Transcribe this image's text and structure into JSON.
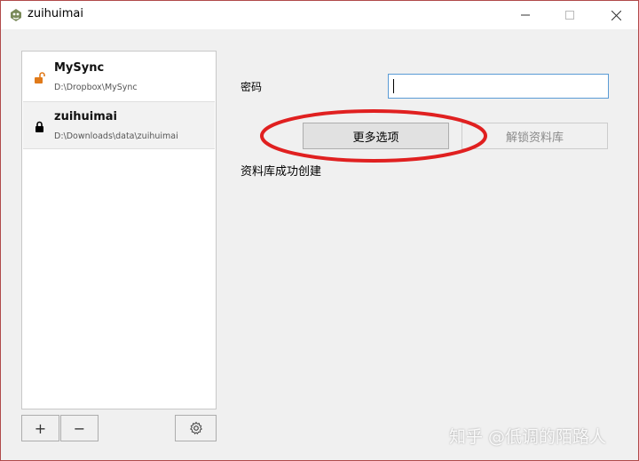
{
  "window": {
    "title": "zuihuimai"
  },
  "repos": [
    {
      "name": "MySync",
      "path": "D:\\Dropbox\\MySync",
      "locked": false
    },
    {
      "name": "zuihuimai",
      "path": "D:\\Downloads\\data\\zuihuimai",
      "locked": true
    }
  ],
  "toolbar": {
    "add_label": "+",
    "remove_label": "−"
  },
  "form": {
    "password_label": "密码",
    "password_value": "",
    "more_options_label": "更多选项",
    "unlock_label": "解锁资料库",
    "status_text": "资料库成功创建"
  },
  "watermark": {
    "text": "知乎 @低调的陌路人"
  },
  "colors": {
    "accent_input_border": "#5a9bd5",
    "unlock_icon": "#e07a1a",
    "annotation": "#e02020"
  }
}
